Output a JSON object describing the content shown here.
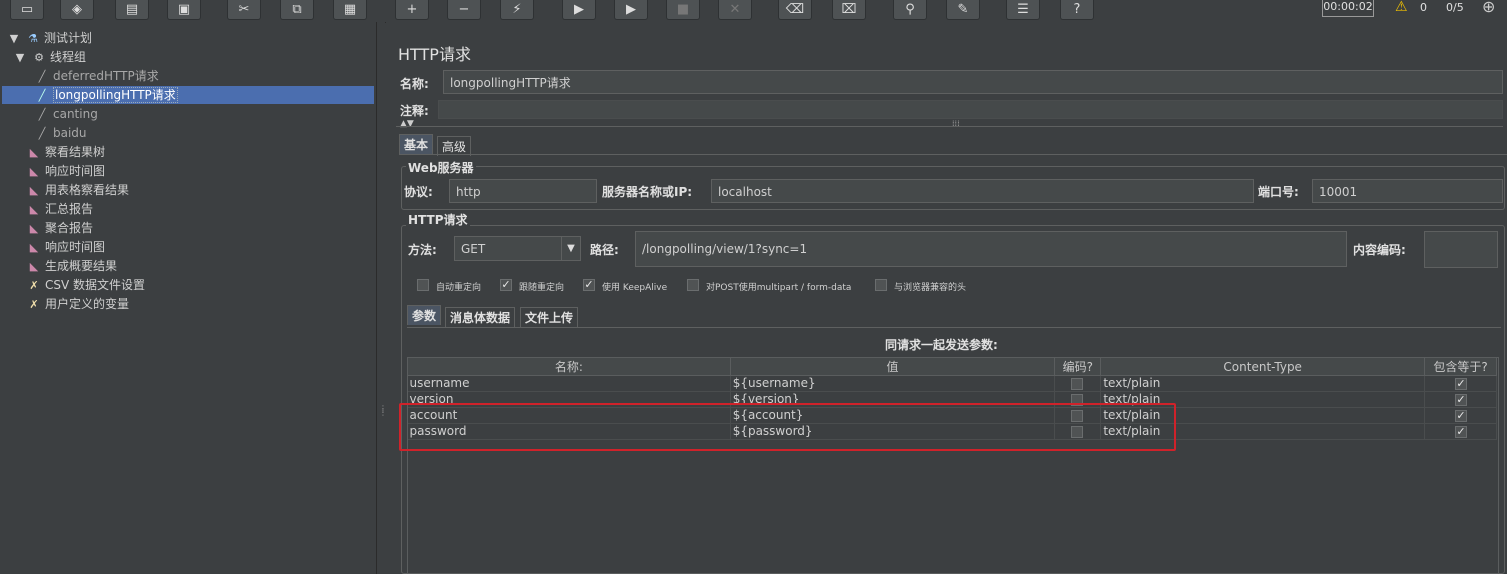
{
  "toolbar": {
    "icons": [
      "new-icon",
      "template-icon",
      "open-icon",
      "save-icon",
      "cut-icon",
      "copy-icon",
      "paste-icon",
      "expand-icon",
      "collapse-icon",
      "toggle-icon",
      "start-icon",
      "start-no-pause-icon",
      "stop-icon",
      "shutdown-icon",
      "clear-icon",
      "clear-all-icon",
      "search-icon",
      "reset-search-icon",
      "function-helper-icon",
      "help-icon"
    ],
    "timer": "00:00:02",
    "warning_count": "0",
    "threads": "0/5"
  },
  "tree": {
    "items": [
      {
        "label": "测试计划",
        "icon": "test-plan-icon"
      },
      {
        "label": "线程组",
        "icon": "thread-group-icon"
      },
      {
        "label": "deferredHTTP请求",
        "icon": "sampler-icon"
      },
      {
        "label": "longpollingHTTP请求",
        "icon": "sampler-icon"
      },
      {
        "label": "canting",
        "icon": "sampler-icon"
      },
      {
        "label": "baidu",
        "icon": "sampler-icon"
      },
      {
        "label": "察看结果树",
        "icon": "listener-icon"
      },
      {
        "label": "响应时间图",
        "icon": "listener-icon"
      },
      {
        "label": "用表格察看结果",
        "icon": "listener-icon"
      },
      {
        "label": "汇总报告",
        "icon": "listener-icon"
      },
      {
        "label": "聚合报告",
        "icon": "listener-icon"
      },
      {
        "label": "响应时间图",
        "icon": "listener-icon"
      },
      {
        "label": "生成概要结果",
        "icon": "listener-icon"
      },
      {
        "label": "CSV 数据文件设置",
        "icon": "config-icon"
      },
      {
        "label": "用户定义的变量",
        "icon": "config-icon"
      }
    ]
  },
  "panel": {
    "title": "HTTP请求",
    "name_label": "名称:",
    "name_value": "longpollingHTTP请求",
    "comment_label": "注释:",
    "tabs": [
      "基本",
      "高级"
    ],
    "web_server": {
      "title": "Web服务器",
      "protocol_label": "协议:",
      "protocol_value": "http",
      "server_label": "服务器名称或IP:",
      "server_value": "localhost",
      "port_label": "端口号:",
      "port_value": "10001"
    },
    "http_request": {
      "title": "HTTP请求",
      "method_label": "方法:",
      "method_value": "GET",
      "path_label": "路径:",
      "path_value": "/longpolling/view/1?sync=1",
      "encoding_label": "内容编码:",
      "encoding_value": "",
      "options": [
        {
          "label": "自动重定向",
          "checked": false
        },
        {
          "label": "跟随重定向",
          "checked": true
        },
        {
          "label": "使用 KeepAlive",
          "checked": true
        },
        {
          "label": "对POST使用multipart / form-data",
          "checked": false
        },
        {
          "label": "与浏览器兼容的头",
          "checked": false
        }
      ]
    },
    "sub_tabs": [
      "参数",
      "消息体数据",
      "文件上传"
    ],
    "params_caption": "同请求一起发送参数:",
    "params_columns": [
      "名称:",
      "值",
      "编码?",
      "Content-Type",
      "包含等于?"
    ],
    "params_rows": [
      {
        "name": "username",
        "value": "${username}",
        "encode": false,
        "content_type": "text/plain",
        "include_equals": true
      },
      {
        "name": "version",
        "value": "${version}",
        "encode": false,
        "content_type": "text/plain",
        "include_equals": true
      },
      {
        "name": "account",
        "value": "${account}",
        "encode": false,
        "content_type": "text/plain",
        "include_equals": true
      },
      {
        "name": "password",
        "value": "${password}",
        "encode": false,
        "content_type": "text/plain",
        "include_equals": true
      }
    ]
  },
  "colors": {
    "background": "#3c3f41",
    "selection": "#4b6eaf",
    "highlight_box": "#d0222a"
  }
}
